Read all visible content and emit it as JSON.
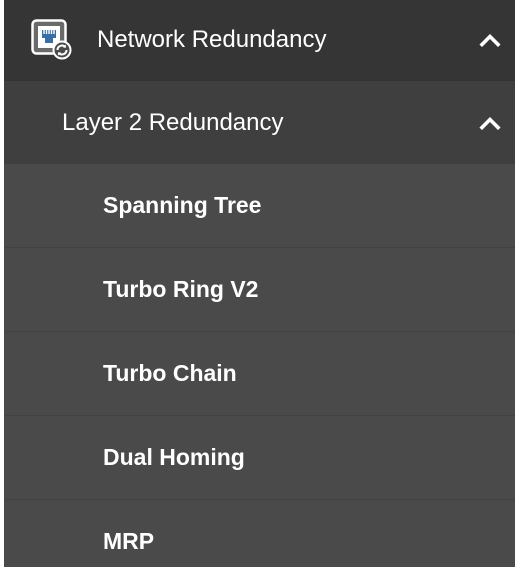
{
  "menu": {
    "section": {
      "label": "Network Redundancy",
      "icon": "network-port-icon",
      "expanded": true
    },
    "subsection": {
      "label": "Layer 2 Redundancy",
      "expanded": true
    },
    "items": [
      {
        "label": "Spanning Tree"
      },
      {
        "label": "Turbo Ring V2"
      },
      {
        "label": "Turbo Chain"
      },
      {
        "label": "Dual Homing"
      },
      {
        "label": "MRP"
      }
    ]
  }
}
